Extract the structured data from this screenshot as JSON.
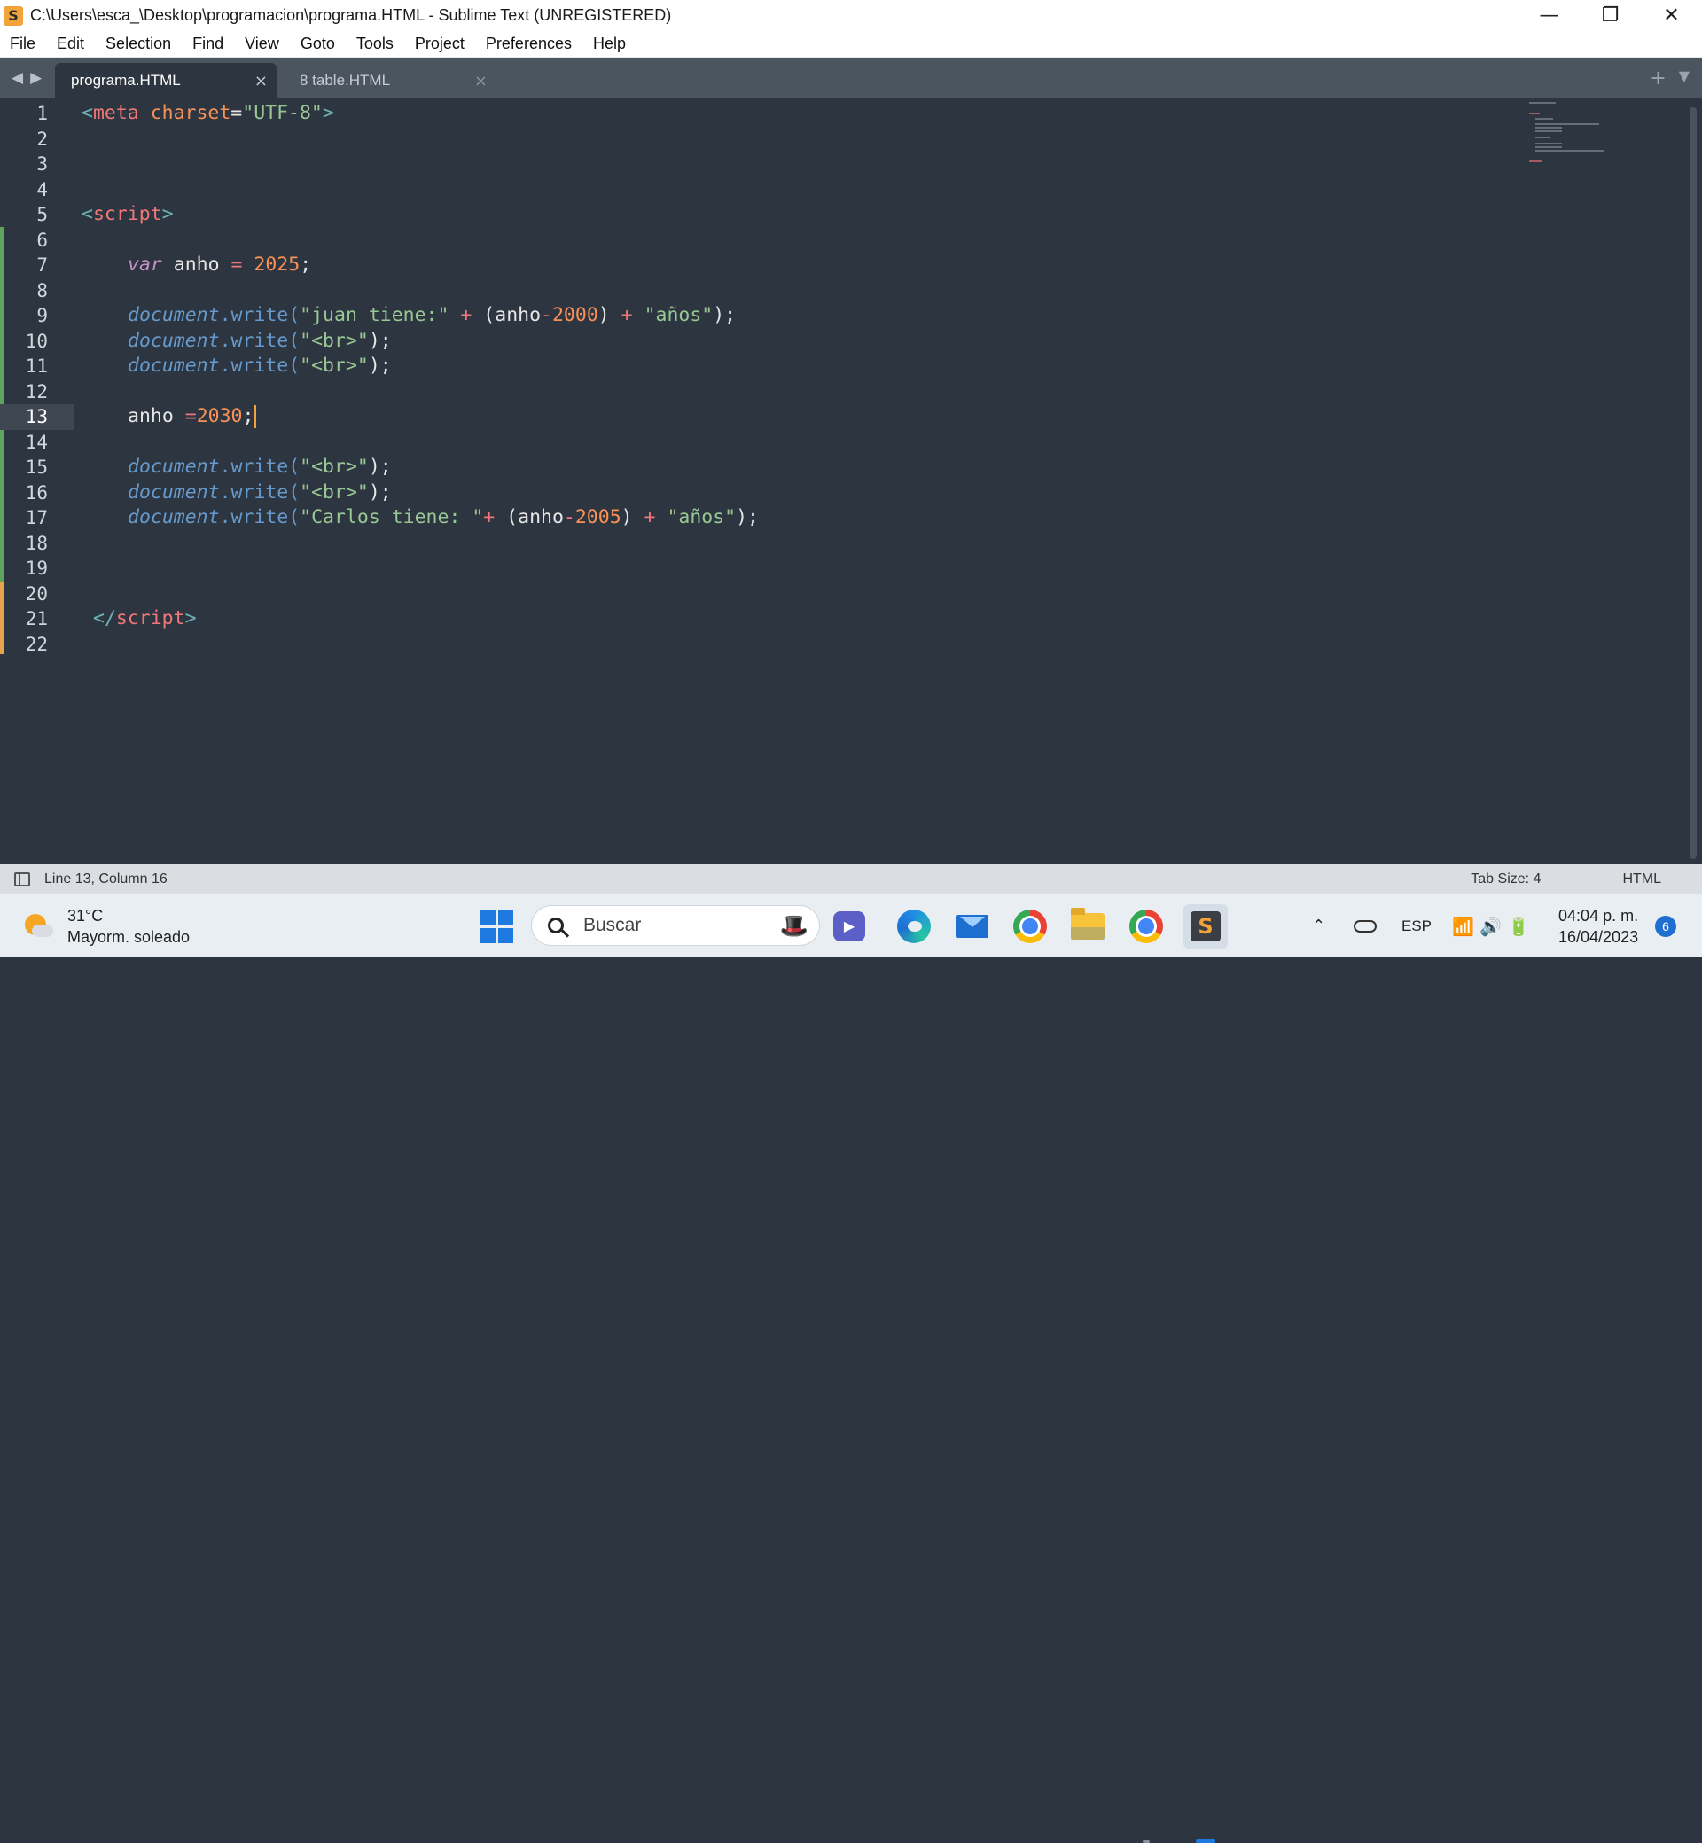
{
  "window": {
    "title": "C:\\Users\\esca_\\Desktop\\programacion\\programa.HTML - Sublime Text (UNREGISTERED)",
    "controls": {
      "minimize": "—",
      "restore": "❐",
      "close": "✕"
    }
  },
  "menu": [
    "File",
    "Edit",
    "Selection",
    "Find",
    "View",
    "Goto",
    "Tools",
    "Project",
    "Preferences",
    "Help"
  ],
  "tabs": [
    {
      "label": "programa.HTML",
      "active": true,
      "close": "×"
    },
    {
      "label": "8 table.HTML",
      "active": false,
      "close": "×"
    }
  ],
  "tab_actions": {
    "new": "+",
    "dropdown": "▼"
  },
  "nav": {
    "back": "◀",
    "forward": "▶"
  },
  "editor": {
    "line_numbers": [
      "1",
      "2",
      "3",
      "4",
      "5",
      "6",
      "7",
      "8",
      "9",
      "10",
      "11",
      "12",
      "13",
      "14",
      "15",
      "16",
      "17",
      "18",
      "19",
      "20",
      "21",
      "22"
    ],
    "current_line": 13,
    "code": {
      "l1": [
        "<",
        "meta",
        " ",
        "charset",
        "=",
        "\"UTF-8\"",
        ">"
      ],
      "l5": [
        "<",
        "script",
        ">"
      ],
      "l7": [
        "var",
        " anho ",
        "=",
        " ",
        "2025",
        ";"
      ],
      "l9": [
        "document",
        ".write(",
        "\"juan tiene:\"",
        " ",
        "+",
        " (anho",
        "-",
        "2000",
        ") ",
        "+",
        " ",
        "\"años\"",
        ");"
      ],
      "l10": [
        "document",
        ".write(",
        "\"<br>\"",
        ");"
      ],
      "l11": [
        "document",
        ".write(",
        "\"<br>\"",
        ");"
      ],
      "l13": [
        "anho ",
        "=",
        "2030",
        ";"
      ],
      "l15": [
        "document",
        ".write(",
        "\"<br>\"",
        ");"
      ],
      "l16": [
        "document",
        ".write(",
        "\"<br>\"",
        ");"
      ],
      "l17": [
        "document",
        ".write(",
        "\"Carlos tiene: \"",
        "+",
        " (anho",
        "-",
        "2005",
        ") ",
        "+",
        " ",
        "\"años\"",
        ");"
      ],
      "l21": [
        "</",
        "script",
        ">"
      ]
    }
  },
  "status": {
    "position": "Line 13, Column 16",
    "tab_size": "Tab Size: 4",
    "syntax": "HTML"
  },
  "taskbar": {
    "weather_temp": "31°C",
    "weather_desc": "Mayorm. soleado",
    "search_placeholder": "Buscar",
    "lang": "ESP",
    "time": "04:04 p. m.",
    "date": "16/04/2023",
    "notifications": "6",
    "tray_up": "⌃",
    "net_icons": "📶 🔊 🔋"
  },
  "colors": {
    "editor_bg": "#2d3640",
    "tag": "#f2777a",
    "string": "#99c794",
    "number": "#f99157",
    "keyword": "#c594c5",
    "object": "#6699cc",
    "accent": "#f2a33a"
  }
}
